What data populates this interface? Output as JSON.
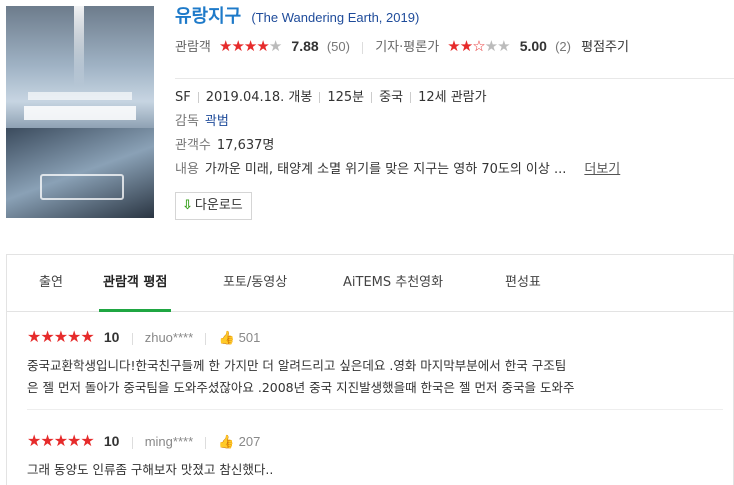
{
  "movie": {
    "title": "유랑지구",
    "original": "(The Wandering Earth, 2019)",
    "audience_label": "관람객",
    "audience_score": "7.88",
    "audience_count": "(50)",
    "critic_label": "기자·평론가",
    "critic_score": "5.00",
    "critic_count": "(2)",
    "rate_label": "평점주기",
    "genre": "SF",
    "release": "2019.04.18. 개봉",
    "runtime": "125분",
    "country": "중국",
    "age": "12세 관람가",
    "director_label": "감독",
    "director": "곽범",
    "viewers_label": "관객수",
    "viewers": "17,637명",
    "plot_label": "내용",
    "plot": "가까운 미래, 태양계 소멸 위기를 맞은 지구는 영하 70도의 이상 ...",
    "more_label": "더보기",
    "download_label": "다운로드"
  },
  "audience_rating_fraction": 0.788,
  "critic_rating_fraction": 0.5,
  "tabs": [
    "출연",
    "관람객 평점",
    "포토/동영상",
    "AiTEMS 추천영화",
    "편성표"
  ],
  "active_tab": "관람객 평점",
  "reviews": [
    {
      "stars": "★★★★★",
      "score": "10",
      "user": "zhuo****",
      "likes": "501",
      "line1": "중국교환학생입니다!한국친구들께 한 가지만 더 알려드리고 싶은데요 .영화 마지막부분에서 한국 구조팀",
      "line2": "은 젤 먼저 돌아가 중국팀을 도와주셨잖아요 .2008년 중국 지진발생했을때 한국은 젤 먼저 중국을 도와주"
    },
    {
      "stars": "★★★★★",
      "score": "10",
      "user": "ming****",
      "likes": "207",
      "line1": "그래 동양도 인류좀 구해보자 맛졌고 참신했다.."
    }
  ],
  "colors": {
    "accent": "#1fa642",
    "star": "#e62b2b",
    "title": "#1e7ac9"
  }
}
